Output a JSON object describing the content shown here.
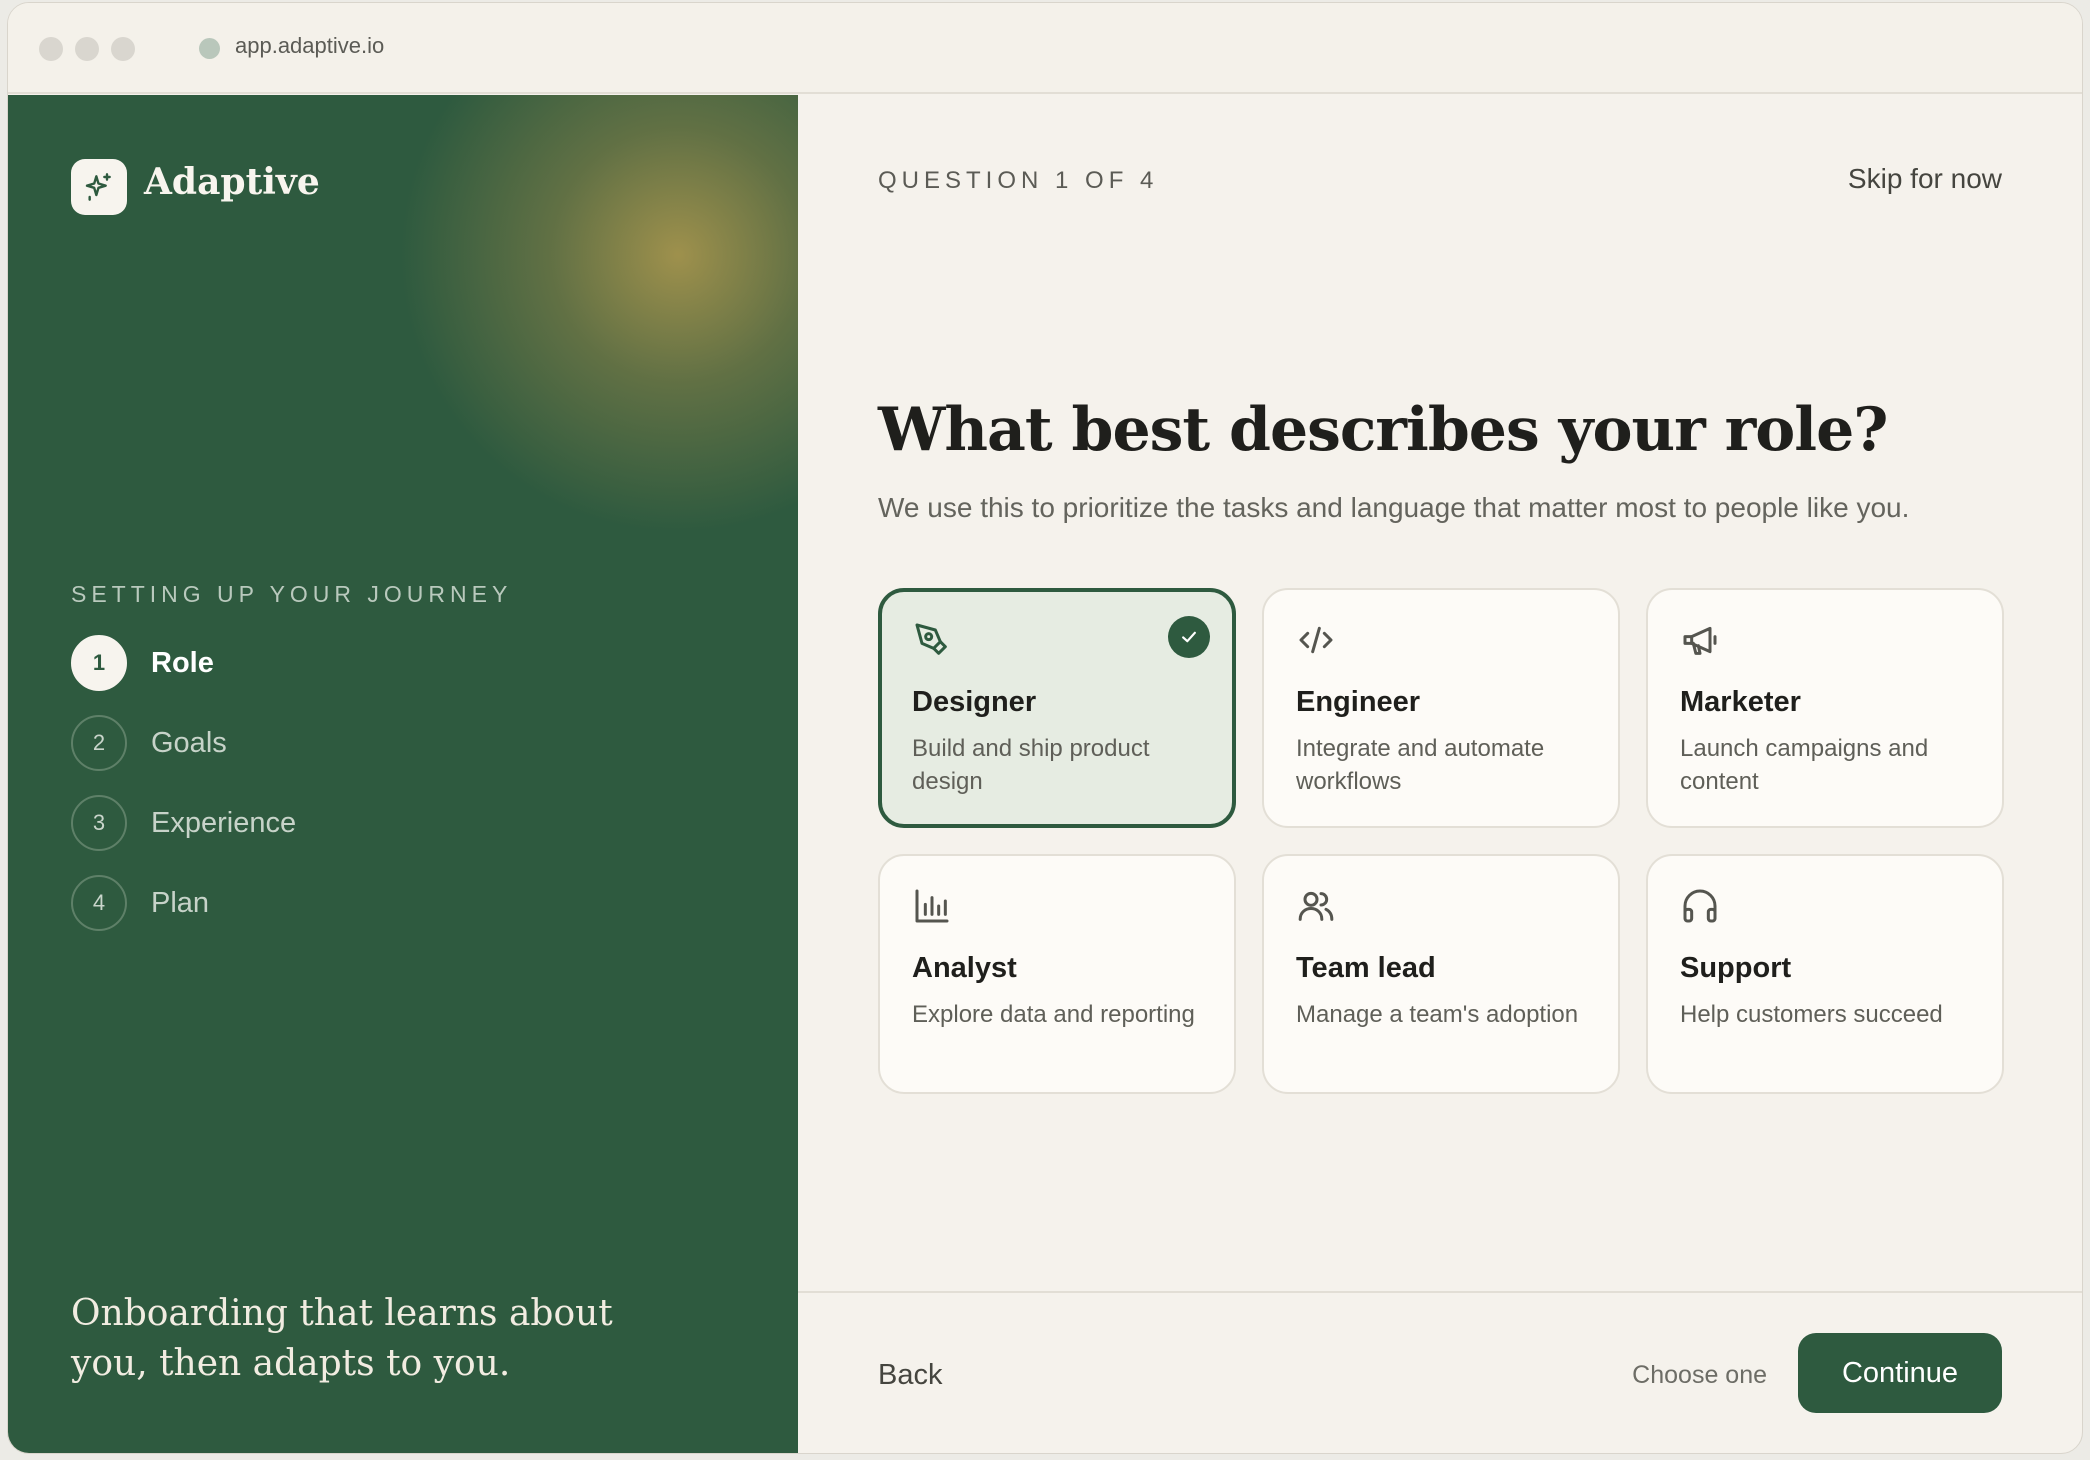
{
  "browser": {
    "url": "app.adaptive.io"
  },
  "brand": {
    "name": "Adaptive"
  },
  "sidebar": {
    "section_label": "SETTING UP YOUR JOURNEY",
    "steps": [
      {
        "number": "1",
        "label": "Role",
        "state": "active"
      },
      {
        "number": "2",
        "label": "Goals",
        "state": "upcoming"
      },
      {
        "number": "3",
        "label": "Experience",
        "state": "upcoming"
      },
      {
        "number": "4",
        "label": "Plan",
        "state": "upcoming"
      }
    ],
    "tagline": "Onboarding that learns about you, then adapts to you."
  },
  "header": {
    "question_count": "QUESTION 1 OF 4",
    "skip_label": "Skip for now"
  },
  "question": {
    "title": "What best describes your role?",
    "subtitle": "We use this to prioritize the tasks and language that matter most to people like you."
  },
  "roles": [
    {
      "title": "Designer",
      "description": "Build and ship product design",
      "icon": "pen-tool-icon",
      "selected": true
    },
    {
      "title": "Engineer",
      "description": "Integrate and automate workflows",
      "icon": "code-icon",
      "selected": false
    },
    {
      "title": "Marketer",
      "description": "Launch campaigns and content",
      "icon": "megaphone-icon",
      "selected": false
    },
    {
      "title": "Analyst",
      "description": "Explore data and reporting",
      "icon": "bar-chart-icon",
      "selected": false
    },
    {
      "title": "Team lead",
      "description": "Manage a team's adoption",
      "icon": "users-icon",
      "selected": false
    },
    {
      "title": "Support",
      "description": "Help customers succeed",
      "icon": "headphones-icon",
      "selected": false
    }
  ],
  "footer": {
    "back_label": "Back",
    "hint": "Choose one",
    "continue_label": "Continue"
  },
  "colors": {
    "brand_green": "#2e5a3f",
    "background": "#f5f2ec",
    "selected_card": "#e6ece2"
  }
}
